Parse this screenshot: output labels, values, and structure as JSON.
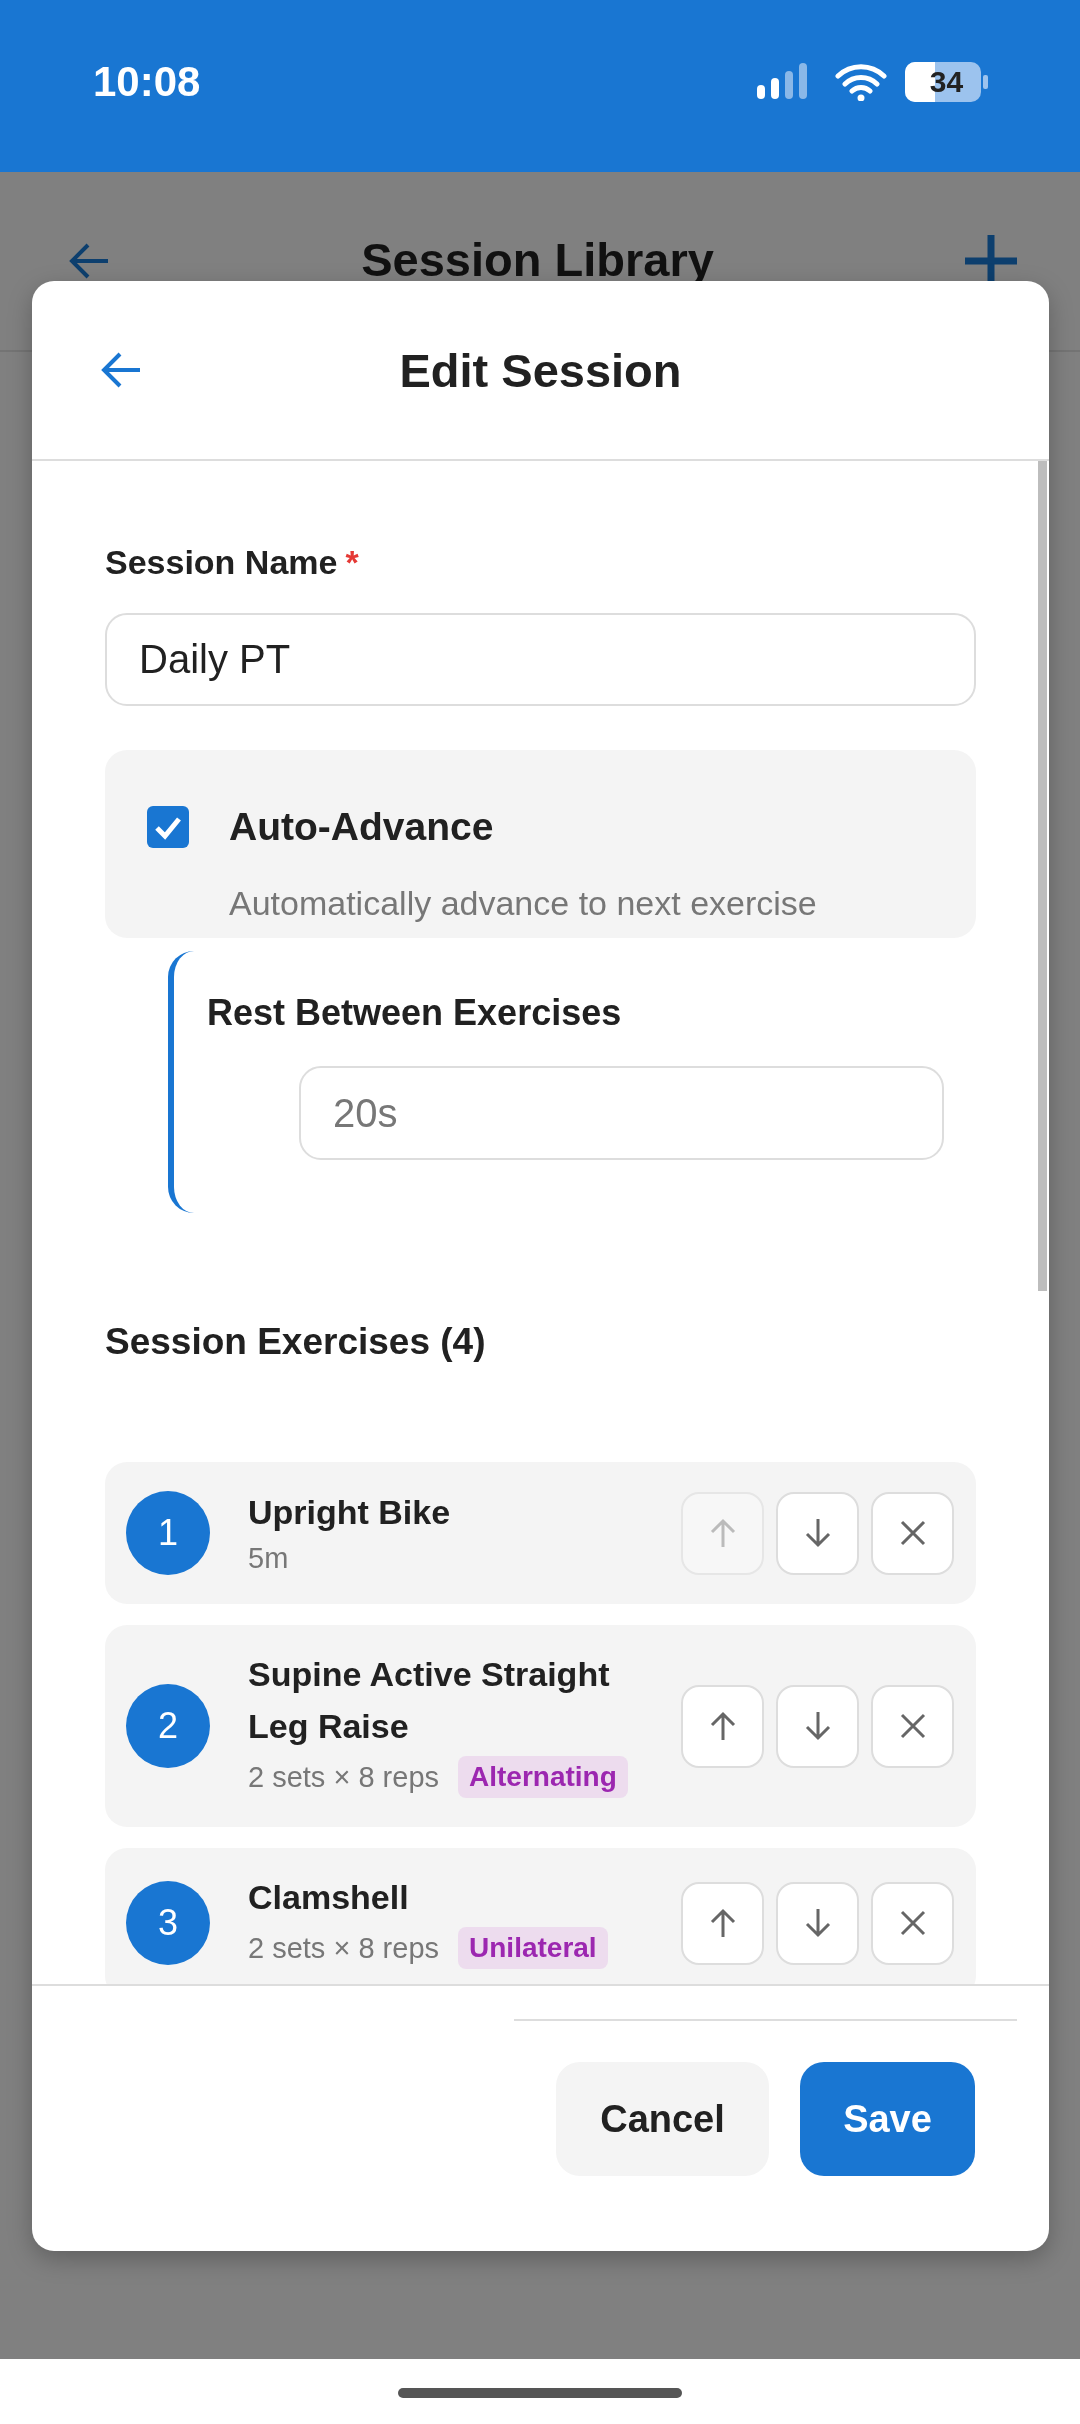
{
  "status_bar": {
    "time": "10:08",
    "battery": "34"
  },
  "background_screen": {
    "title": "Session Library"
  },
  "dialog": {
    "title": "Edit Session",
    "session_name": {
      "label": "Session Name",
      "required_mark": "*",
      "value": "Daily PT"
    },
    "auto_advance": {
      "label": "Auto-Advance",
      "description": "Automatically advance to next exercise",
      "checked": true
    },
    "rest": {
      "label": "Rest Between Exercises",
      "placeholder": "20s"
    },
    "exercises_heading": "Session Exercises (4)",
    "exercises": [
      {
        "number": "1",
        "name": "Upright Bike",
        "detail": "5m",
        "move_up_disabled": true
      },
      {
        "number": "2",
        "name": "Supine Active Straight Leg Raise",
        "detail": "2 sets × 8 reps",
        "tag": "Alternating",
        "move_up_disabled": false
      },
      {
        "number": "3",
        "name": "Clamshell",
        "detail": "2 sets × 8 reps",
        "tag": "Unilateral",
        "move_up_disabled": false
      }
    ],
    "buttons": [
      {
        "label": "Cancel",
        "kind": "secondary"
      },
      {
        "label": "Save",
        "kind": "primary"
      }
    ]
  }
}
